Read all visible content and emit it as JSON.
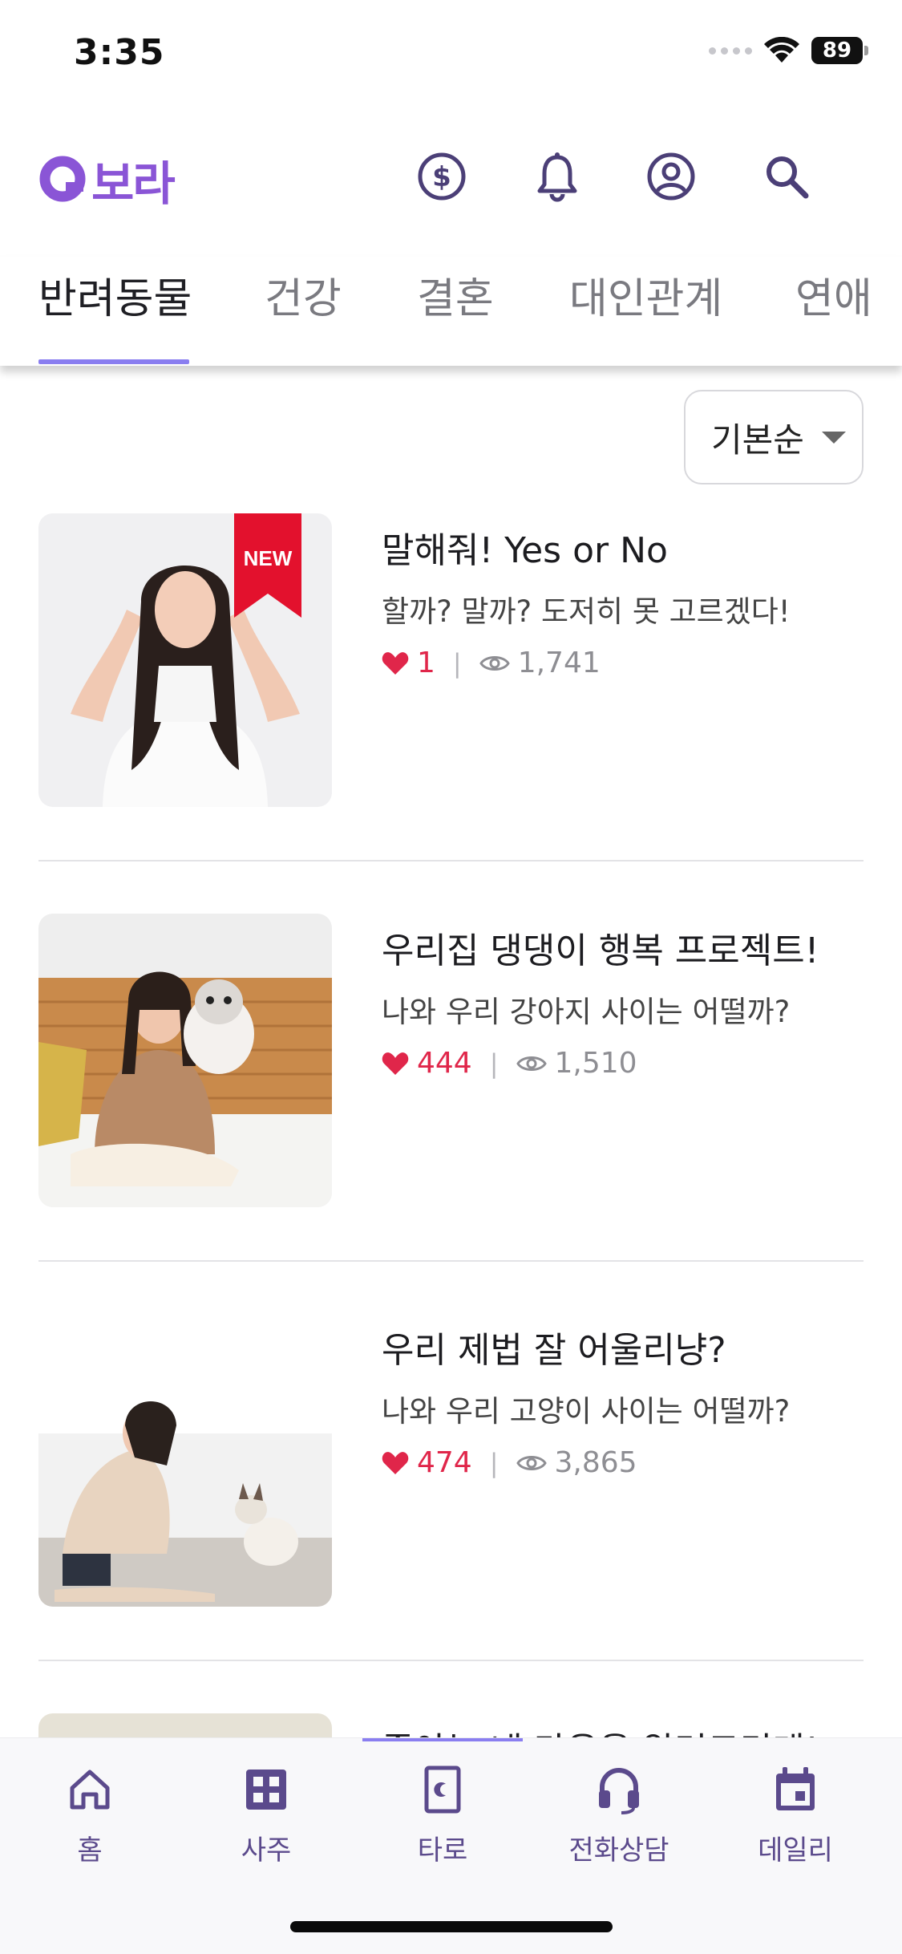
{
  "status_bar": {
    "time": "3:35",
    "battery": "89"
  },
  "header": {
    "logo_text": "보라",
    "icons": [
      "coin-icon",
      "bell-icon",
      "profile-icon",
      "search-icon"
    ]
  },
  "tabs": [
    {
      "label": "반려동물",
      "active": true
    },
    {
      "label": "건강",
      "active": false
    },
    {
      "label": "결혼",
      "active": false
    },
    {
      "label": "대인관계",
      "active": false
    },
    {
      "label": "연애",
      "active": false
    }
  ],
  "sort": {
    "label": "기본순"
  },
  "items": [
    {
      "title": "말해줘! Yes or No",
      "description": "할까? 말까? 도저히 못 고르겠다!",
      "likes": "1",
      "views": "1,741",
      "badge": "NEW"
    },
    {
      "title": "우리집 댕댕이 행복 프로젝트!",
      "description": "나와 우리 강아지 사이는 어떨까?",
      "likes": "444",
      "views": "1,510"
    },
    {
      "title": "우리 제법 잘 어울리냥?",
      "description": "나와 우리 고양이 사이는 어떨까?",
      "likes": "474",
      "views": "3,865"
    },
    {
      "title": "좋아는 네 마음을 알려드리게!"
    }
  ],
  "bottom_nav": [
    {
      "label": "홈",
      "icon": "home-icon"
    },
    {
      "label": "사주",
      "icon": "grid-icon"
    },
    {
      "label": "타로",
      "icon": "tarot-card-icon"
    },
    {
      "label": "전화상담",
      "icon": "headset-icon"
    },
    {
      "label": "데일리",
      "icon": "calendar-icon"
    }
  ],
  "colors": {
    "accent": "#8a55d6",
    "heart": "#e0264a",
    "nav": "#5b4a8c",
    "badge": "#e3112d"
  }
}
